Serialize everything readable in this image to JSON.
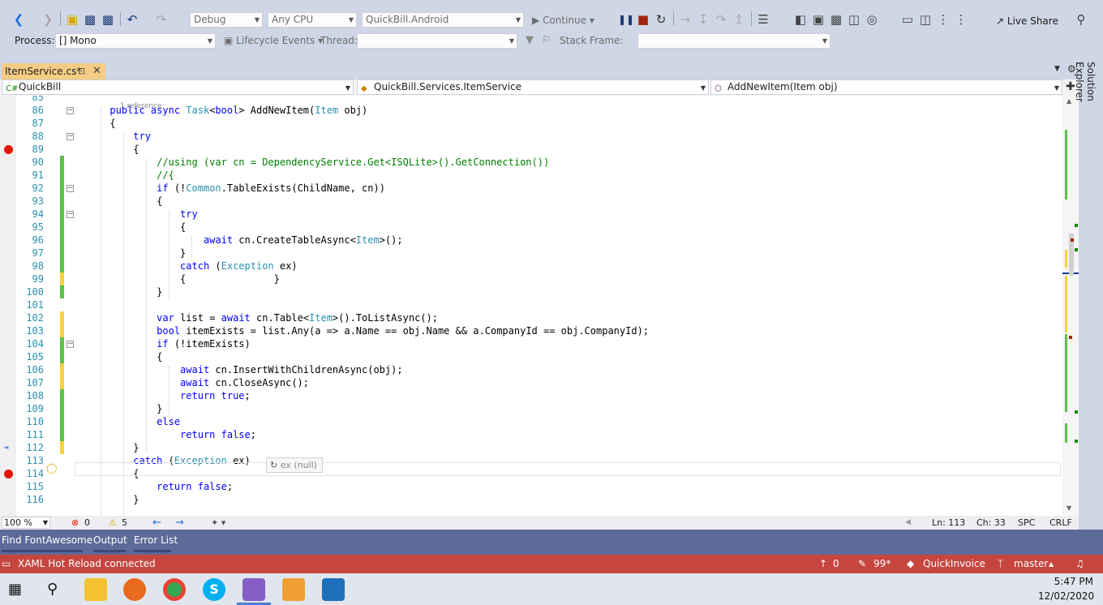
{
  "toolbar": {
    "config": "Debug",
    "platform": "Any CPU",
    "startup_project": "QuickBill.Android",
    "continue_label": "Continue",
    "live_share": "Live Share"
  },
  "debug_bar": {
    "process_label": "Process:",
    "process_value": "[] Mono",
    "lifecycle_label": "Lifecycle Events",
    "thread_label": "Thread:",
    "stack_frame_label": "Stack Frame:"
  },
  "tab": {
    "title": "ItemService.cs*"
  },
  "nav": {
    "project": "QuickBill",
    "class": "QuickBill.Services.ItemService",
    "member": "AddNewItem(Item obj)"
  },
  "editor": {
    "codelens": "1 reference",
    "datatip_name": "ex",
    "datatip_value": "(null)",
    "lines": [
      {
        "n": "85",
        "t": []
      },
      {
        "n": "86",
        "t": [
          [
            "      ",
            ""
          ],
          [
            "public async ",
            "kw"
          ],
          [
            "Task",
            "ty"
          ],
          [
            "<",
            ""
          ],
          [
            "bool",
            "kw"
          ],
          [
            "> AddNewItem(",
            ""
          ],
          [
            "Item",
            "ty"
          ],
          [
            " obj)",
            ""
          ]
        ]
      },
      {
        "n": "87",
        "t": [
          [
            "      {",
            ""
          ]
        ]
      },
      {
        "n": "88",
        "t": [
          [
            "          ",
            ""
          ],
          [
            "try",
            "kw"
          ]
        ]
      },
      {
        "n": "89",
        "t": [
          [
            "          {",
            ""
          ]
        ]
      },
      {
        "n": "90",
        "t": [
          [
            "              //using (var cn = DependencyService.Get<ISQLite>().GetConnection())",
            "cm"
          ]
        ]
      },
      {
        "n": "91",
        "t": [
          [
            "              //{",
            "cm"
          ]
        ]
      },
      {
        "n": "92",
        "t": [
          [
            "              ",
            ""
          ],
          [
            "if",
            "kw"
          ],
          [
            " (!",
            ""
          ],
          [
            "Common",
            "ty"
          ],
          [
            ".TableExists(ChildName, cn))",
            ""
          ]
        ]
      },
      {
        "n": "93",
        "t": [
          [
            "              {",
            ""
          ]
        ]
      },
      {
        "n": "94",
        "t": [
          [
            "                  ",
            ""
          ],
          [
            "try",
            "kw"
          ]
        ]
      },
      {
        "n": "95",
        "t": [
          [
            "                  {",
            ""
          ]
        ]
      },
      {
        "n": "96",
        "t": [
          [
            "                      ",
            ""
          ],
          [
            "await",
            "kw"
          ],
          [
            " cn.CreateTableAsync<",
            ""
          ],
          [
            "Item",
            "ty"
          ],
          [
            ">();",
            ""
          ]
        ]
      },
      {
        "n": "97",
        "t": [
          [
            "                  }",
            ""
          ]
        ]
      },
      {
        "n": "98",
        "t": [
          [
            "                  ",
            ""
          ],
          [
            "catch",
            "kw"
          ],
          [
            " (",
            ""
          ],
          [
            "Exception",
            "ty"
          ],
          [
            " ex)",
            ""
          ]
        ]
      },
      {
        "n": "99",
        "t": [
          [
            "                  {               }",
            ""
          ]
        ]
      },
      {
        "n": "100",
        "t": [
          [
            "              }",
            ""
          ]
        ]
      },
      {
        "n": "101",
        "t": []
      },
      {
        "n": "102",
        "t": [
          [
            "              ",
            ""
          ],
          [
            "var",
            "kw"
          ],
          [
            " list = ",
            ""
          ],
          [
            "await",
            "kw"
          ],
          [
            " cn.Table<",
            ""
          ],
          [
            "Item",
            "ty"
          ],
          [
            ">().ToListAsync();",
            ""
          ]
        ]
      },
      {
        "n": "103",
        "t": [
          [
            "              ",
            ""
          ],
          [
            "bool",
            "kw"
          ],
          [
            " itemExists = list.Any(a => a.Name == obj.Name && a.CompanyId == obj.CompanyId);",
            ""
          ]
        ]
      },
      {
        "n": "104",
        "t": [
          [
            "              ",
            ""
          ],
          [
            "if",
            "kw"
          ],
          [
            " (!itemExists)",
            ""
          ]
        ]
      },
      {
        "n": "105",
        "t": [
          [
            "              {",
            ""
          ]
        ]
      },
      {
        "n": "106",
        "t": [
          [
            "                  ",
            ""
          ],
          [
            "await",
            "kw"
          ],
          [
            " cn.InsertWithChildrenAsync(obj);",
            ""
          ]
        ]
      },
      {
        "n": "107",
        "t": [
          [
            "                  ",
            ""
          ],
          [
            "await",
            "kw"
          ],
          [
            " cn.CloseAsync();",
            ""
          ]
        ]
      },
      {
        "n": "108",
        "t": [
          [
            "                  ",
            ""
          ],
          [
            "return true",
            "kw"
          ],
          [
            ";",
            ""
          ]
        ]
      },
      {
        "n": "109",
        "t": [
          [
            "              }",
            ""
          ]
        ]
      },
      {
        "n": "110",
        "t": [
          [
            "              ",
            ""
          ],
          [
            "else",
            "kw"
          ]
        ]
      },
      {
        "n": "111",
        "t": [
          [
            "                  ",
            ""
          ],
          [
            "return false",
            "kw"
          ],
          [
            ";",
            ""
          ]
        ]
      },
      {
        "n": "112",
        "t": [
          [
            "          }",
            ""
          ]
        ]
      },
      {
        "n": "113",
        "t": [
          [
            "          ",
            ""
          ],
          [
            "catch",
            "kw"
          ],
          [
            " (",
            ""
          ],
          [
            "Exception",
            "ty"
          ],
          [
            " ex)",
            ""
          ]
        ]
      },
      {
        "n": "114",
        "t": [
          [
            "          {",
            ""
          ]
        ]
      },
      {
        "n": "115",
        "t": [
          [
            "              ",
            ""
          ],
          [
            "return false",
            "kw"
          ],
          [
            ";",
            ""
          ]
        ]
      },
      {
        "n": "116",
        "t": [
          [
            "          }",
            ""
          ]
        ]
      }
    ]
  },
  "editor_status": {
    "zoom": "100 %",
    "errors": "0",
    "warnings": "5",
    "line": "Ln: 113",
    "col": "Ch: 33",
    "spc": "SPC",
    "crlf": "CRLF"
  },
  "right_rail": {
    "solution_explorer": "Solution Explorer"
  },
  "bottom_tabs": [
    "Find FontAwesome",
    "Output",
    "Error List"
  ],
  "status_bar": {
    "message": "XAML Hot Reload connected",
    "up_count": "0",
    "pending": "99*",
    "repo": "QuickInvoice",
    "branch": "master"
  },
  "taskbar": {
    "time": "5:47 PM",
    "date": "12/02/2020"
  },
  "colors": {
    "status_bar": "#c6463f",
    "bottom_tabs": "#5d6b99",
    "tab_active": "#f5cc84",
    "breakpoint": "#e51400"
  }
}
